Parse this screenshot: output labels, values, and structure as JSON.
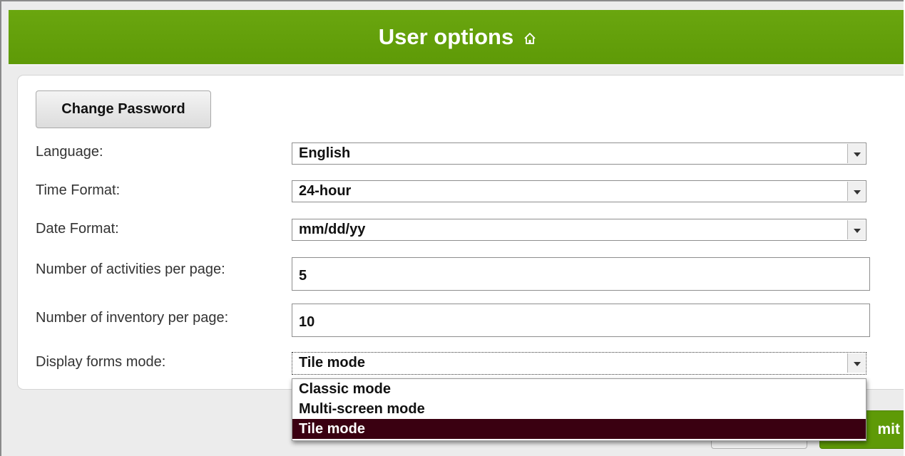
{
  "header": {
    "title": "User options",
    "icon": "home-icon",
    "color": "#5e9a07"
  },
  "change_password_label": "Change Password",
  "fields": {
    "language": {
      "label": "Language:",
      "value": "English"
    },
    "time_format": {
      "label": "Time Format:",
      "value": "24-hour"
    },
    "date_format": {
      "label": "Date Format:",
      "value": "mm/dd/yy"
    },
    "activities_per_page": {
      "label": "Number of activities per page:",
      "value": "5"
    },
    "inventory_per_page": {
      "label": "Number of inventory per page:",
      "value": "10"
    },
    "display_forms_mode": {
      "label": "Display forms mode:",
      "value": "Tile mode",
      "options": [
        "Classic mode",
        "Multi-screen mode",
        "Tile mode"
      ],
      "selected_option": "Tile mode"
    }
  },
  "footer": {
    "submit_label_visible": "mit",
    "submit_color": "#5e9a07",
    "selected_option_color": "#3a0011"
  }
}
